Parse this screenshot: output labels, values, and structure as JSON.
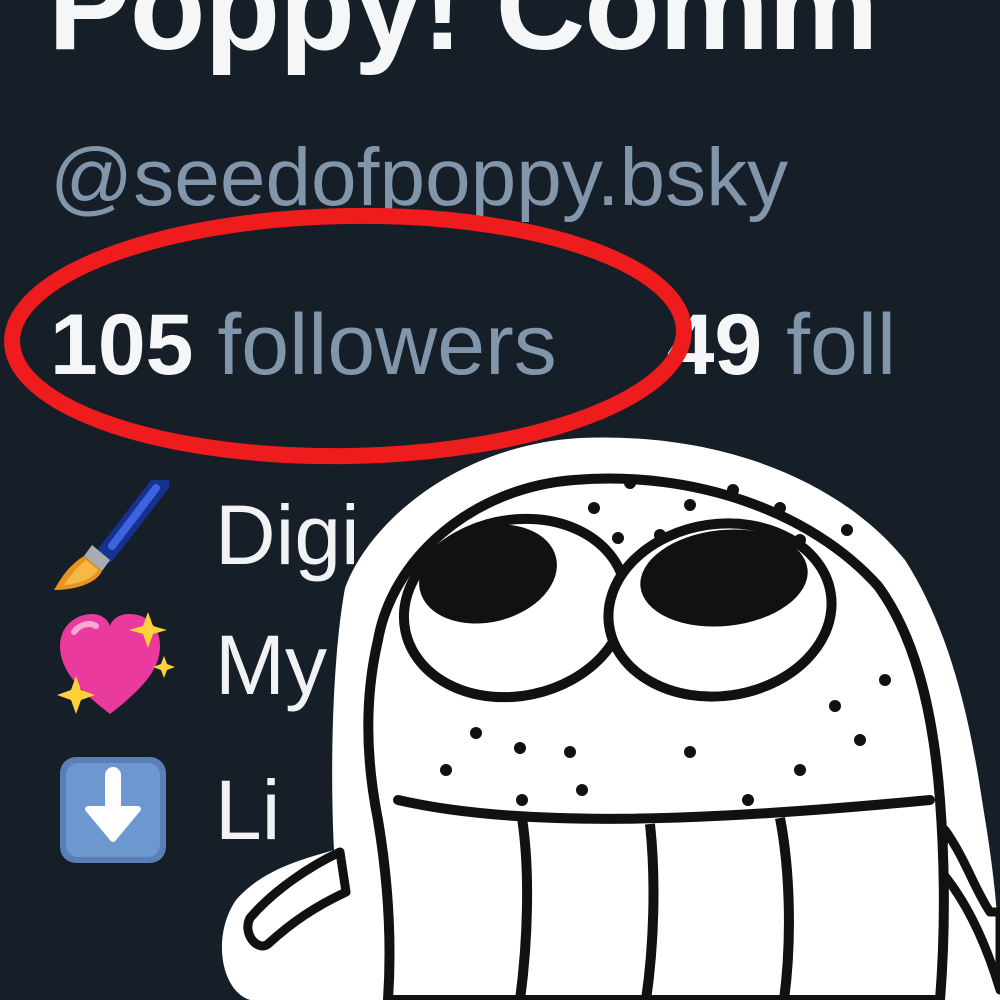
{
  "profile": {
    "display_name": "Poppy! Comm",
    "handle": "@seedofpoppy.bsky",
    "followers_count": "105",
    "followers_label": "followers",
    "following_count": "49",
    "following_label": "foll",
    "bio_lines": [
      {
        "icon": "paintbrush-icon",
        "text": "Digi"
      },
      {
        "icon": "sparkling-heart-icon",
        "text": "My"
      },
      {
        "icon": "down-arrow-icon",
        "text": "Li"
      }
    ]
  },
  "annotation": {
    "highlight_color": "#ee1c1c"
  },
  "sticker": {
    "icon": "cartoon-creature-sticker"
  }
}
